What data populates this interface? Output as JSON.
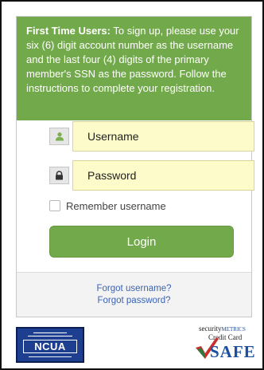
{
  "notice": {
    "heading": "First Time Users:",
    "body": " To sign up, please use your six (6) digit account number as the username and the last four (4) digits of the primary member's SSN as the password. Follow the instructions to complete your registration."
  },
  "form": {
    "username_placeholder": "Username",
    "password_placeholder": "Password",
    "remember_label": "Remember username",
    "login_label": "Login"
  },
  "links": {
    "forgot_username": "Forgot username?",
    "forgot_password": "Forgot password?"
  },
  "badges": {
    "ncua_label": "NCUA",
    "security_brand": "security",
    "security_brand_suffix": "METRICS",
    "credit_card": "Credit Card",
    "safe": "SAFE"
  },
  "colors": {
    "accent_green": "#72a94a",
    "input_fill": "#fdfbc9",
    "link_blue": "#3b63b5",
    "ncua_blue": "#1e3f8f"
  },
  "icons": {
    "username": "user-icon",
    "password": "lock-icon",
    "security_badge": "checkmark-icon"
  }
}
